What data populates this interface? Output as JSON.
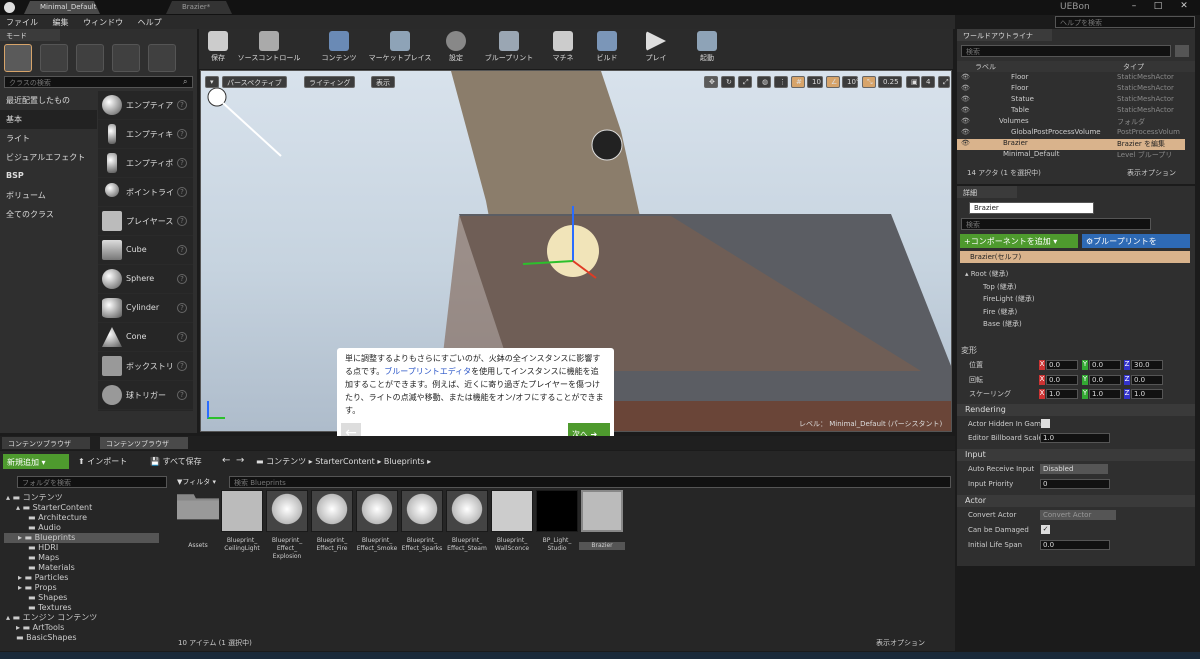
{
  "window": {
    "tabs": [
      "Minimal_Default*",
      "Brazier*"
    ],
    "user": "UEBon",
    "help_search_placeholder": "ヘルプを検索"
  },
  "menu": [
    "ファイル",
    "編集",
    "ウィンドウ",
    "ヘルプ"
  ],
  "modes": {
    "tab": "モード",
    "search_placeholder": "クラスの検索",
    "categories": [
      "最近配置したもの",
      "基本",
      "ライト",
      "ビジュアルエフェクト",
      "BSP",
      "ボリューム",
      "全てのクラス"
    ],
    "items": [
      "エンプティア",
      "エンプティキ",
      "エンプティポ",
      "ポイントライ",
      "プレイヤース",
      "Cube",
      "Sphere",
      "Cylinder",
      "Cone",
      "ボックストリ",
      "球トリガー"
    ]
  },
  "toolbar": {
    "items": [
      "保存",
      "ソースコントロール",
      "コンテンツ",
      "マーケットプレイス",
      "設定",
      "ブループリント",
      "マチネ",
      "ビルド",
      "プレイ",
      "起動"
    ]
  },
  "viewport": {
    "perspective": "パースペクティブ",
    "lighting": "ライティング",
    "show": "表示",
    "grid_size": "10",
    "rot_snap": "10°",
    "scale_snap": "0.25",
    "camera_speed": "4",
    "level_label": "レベル： Minimal_Default (パーシスタント)"
  },
  "tutorial": {
    "text_before": "単に調整するよりもさらにすごいのが、火鉢の全インスタンスに影響する点です。",
    "link": "ブループリントエディタ",
    "text_after": "を使用してインスタンスに機能を追加することができます。例えば、近くに寄り過ぎたプレイヤーを傷つけたり、ライトの点滅や移動、または機能をオン/オフにすることができます。",
    "next": "次へ"
  },
  "outliner": {
    "tab": "ワールドアウトライナ",
    "search_placeholder": "検索",
    "col_label": "ラベル",
    "col_type": "タイプ",
    "rows": [
      {
        "name": "Floor",
        "type": "StaticMeshActor"
      },
      {
        "name": "Floor",
        "type": "StaticMeshActor"
      },
      {
        "name": "Statue",
        "type": "StaticMeshActor"
      },
      {
        "name": "Table",
        "type": "StaticMeshActor"
      },
      {
        "name": "Volumes",
        "type": "フォルダ"
      },
      {
        "name": "GlobalPostProcessVolume",
        "type": "PostProcessVolum"
      },
      {
        "name": "Brazier",
        "type": "Brazier を編集"
      },
      {
        "name": "Minimal_Default",
        "type": "Level ブループリ"
      }
    ],
    "count": "14 アクタ (1 を選択中)",
    "view_options": "表示オプション"
  },
  "details": {
    "tab": "詳細",
    "name": "Brazier",
    "search_placeholder": "検索",
    "add_component": "コンポーネントを追加",
    "blueprint_button": "ブループリントを",
    "self": "Brazier(セルフ)",
    "components": [
      "Root (継承)",
      "Top (継承)",
      "FireLight (継承)",
      "Fire (継承)",
      "Base (継承)"
    ],
    "transform_header": "変形",
    "location_label": "位置",
    "rotation_label": "回転",
    "scale_label": "スケーリング",
    "location": [
      "0.0",
      "0.0",
      "30.0"
    ],
    "rotation": [
      "0.0",
      "0.0",
      "0.0"
    ],
    "scale": [
      "1.0",
      "1.0",
      "1.0"
    ],
    "rendering_header": "Rendering",
    "actor_hidden": "Actor Hidden In Game",
    "billboard_scale_label": "Editor Billboard Scale",
    "billboard_scale": "1.0",
    "input_header": "Input",
    "auto_receive_label": "Auto Receive Input",
    "auto_receive_value": "Disabled",
    "input_priority_label": "Input Priority",
    "input_priority": "0",
    "actor_header": "Actor",
    "convert_label": "Convert Actor",
    "convert_value": "Convert Actor",
    "can_damaged": "Can be Damaged",
    "lifespan_label": "Initial Life Span",
    "lifespan": "0.0"
  },
  "content_browser": {
    "tabs": [
      "コンテンツブラウザ",
      "コンテンツブラウザ"
    ],
    "add_new": "新規追加",
    "import": "インポート",
    "save_all": "すべて保存",
    "path": [
      "コンテンツ",
      "StarterContent",
      "Blueprints"
    ],
    "folder_search_placeholder": "フォルダを検索",
    "filter": "フィルタ",
    "search_placeholder": "検索 Blueprints",
    "tree": [
      {
        "label": "コンテンツ",
        "level": 0
      },
      {
        "label": "StarterContent",
        "level": 1
      },
      {
        "label": "Architecture",
        "level": 2
      },
      {
        "label": "Audio",
        "level": 2
      },
      {
        "label": "Blueprints",
        "level": 2
      },
      {
        "label": "HDRI",
        "level": 2
      },
      {
        "label": "Maps",
        "level": 2
      },
      {
        "label": "Materials",
        "level": 2
      },
      {
        "label": "Particles",
        "level": 2
      },
      {
        "label": "Props",
        "level": 2
      },
      {
        "label": "Shapes",
        "level": 2
      },
      {
        "label": "Textures",
        "level": 2
      },
      {
        "label": "エンジン コンテンツ",
        "level": 0
      },
      {
        "label": "ArtTools",
        "level": 1
      },
      {
        "label": "BasicShapes",
        "level": 1
      }
    ],
    "assets": [
      "Assets",
      "Blueprint_ CeilingLight",
      "Blueprint_ Effect_ Explosion",
      "Blueprint_ Effect_Fire",
      "Blueprint_ Effect_Smoke",
      "Blueprint_ Effect_Sparks",
      "Blueprint_ Effect_Steam",
      "Blueprint_ WallSconce",
      "BP_Light_ Studio",
      "Brazier"
    ],
    "count": "10 アイテム (1 選択中)",
    "view_options": "表示オプション"
  },
  "colors": {
    "accent": "#d7a46a",
    "green": "#4e9a2e",
    "blue": "#2e6ab5"
  }
}
